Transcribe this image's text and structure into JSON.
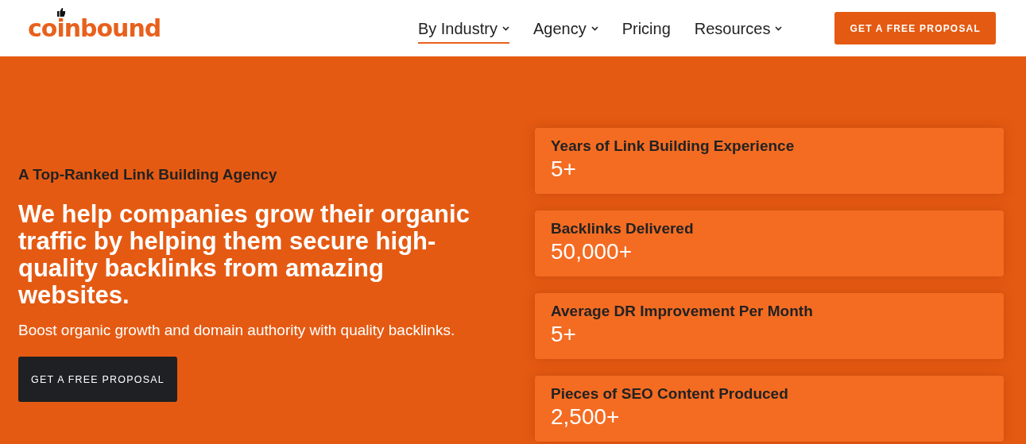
{
  "header": {
    "logo": "coinbound",
    "nav": [
      {
        "label": "By Industry",
        "dropdown": true,
        "selected": true
      },
      {
        "label": "Agency",
        "dropdown": true,
        "selected": false
      },
      {
        "label": "Pricing",
        "dropdown": false,
        "selected": false
      },
      {
        "label": "Resources",
        "dropdown": true,
        "selected": false
      }
    ],
    "cta": "GET A FREE PROPOSAL"
  },
  "hero": {
    "eyebrow": "A Top-Ranked Link Building Agency",
    "headline": "We help companies grow their organic traffic by helping them secure high-quality backlinks from amazing websites.",
    "subtext": "Boost organic growth and domain authority with quality backlinks.",
    "cta": "GET A FREE PROPOSAL"
  },
  "stats": [
    {
      "label": "Years of Link Building Experience",
      "value": "5+"
    },
    {
      "label": "Backlinks Delivered",
      "value": "50,000+"
    },
    {
      "label": "Average DR Improvement Per Month",
      "value": "5+"
    },
    {
      "label": "Pieces of SEO Content Produced",
      "value": "2,500+"
    }
  ]
}
